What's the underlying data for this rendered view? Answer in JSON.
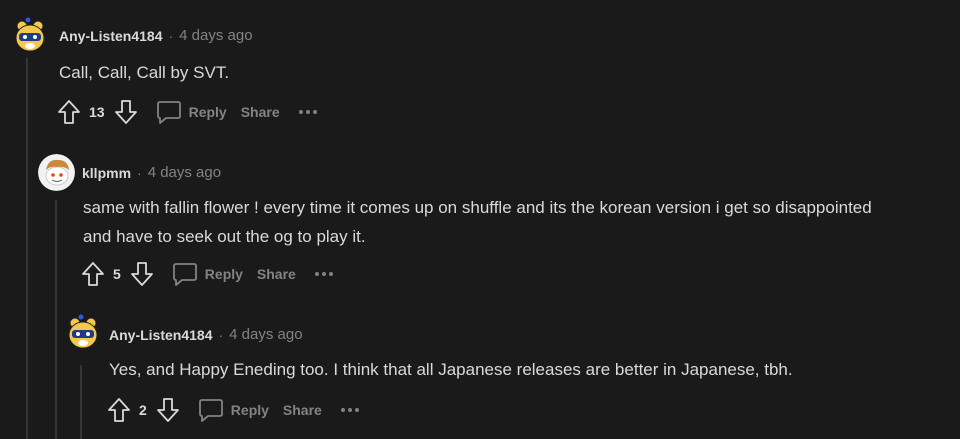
{
  "colors": {
    "background": "#1a1a1b",
    "text": "#d7dadc",
    "muted": "#818384",
    "thread_line": "#343536"
  },
  "separator": "·",
  "comments": [
    {
      "author": "Any-Listen4184",
      "time": "4 days ago",
      "body": [
        "Call, Call, Call by SVT."
      ],
      "score": "13",
      "reply_label": "Reply",
      "share_label": "Share",
      "avatar_icon": "yellow-bear-avatar-icon"
    },
    {
      "author": "kllpmm",
      "time": "4 days ago",
      "body": [
        "same with fallin flower ! every time it comes up on shuffle and its the korean version i get so disappointed",
        "and have to seek out the og to play it."
      ],
      "score": "5",
      "reply_label": "Reply",
      "share_label": "Share",
      "avatar_icon": "snoo-avatar-icon"
    },
    {
      "author": "Any-Listen4184",
      "time": "4 days ago",
      "body": [
        "Yes, and Happy Eneding too. I think that all Japanese releases are better in Japanese, tbh."
      ],
      "score": "2",
      "reply_label": "Reply",
      "share_label": "Share",
      "avatar_icon": "yellow-bear-avatar-icon"
    }
  ]
}
